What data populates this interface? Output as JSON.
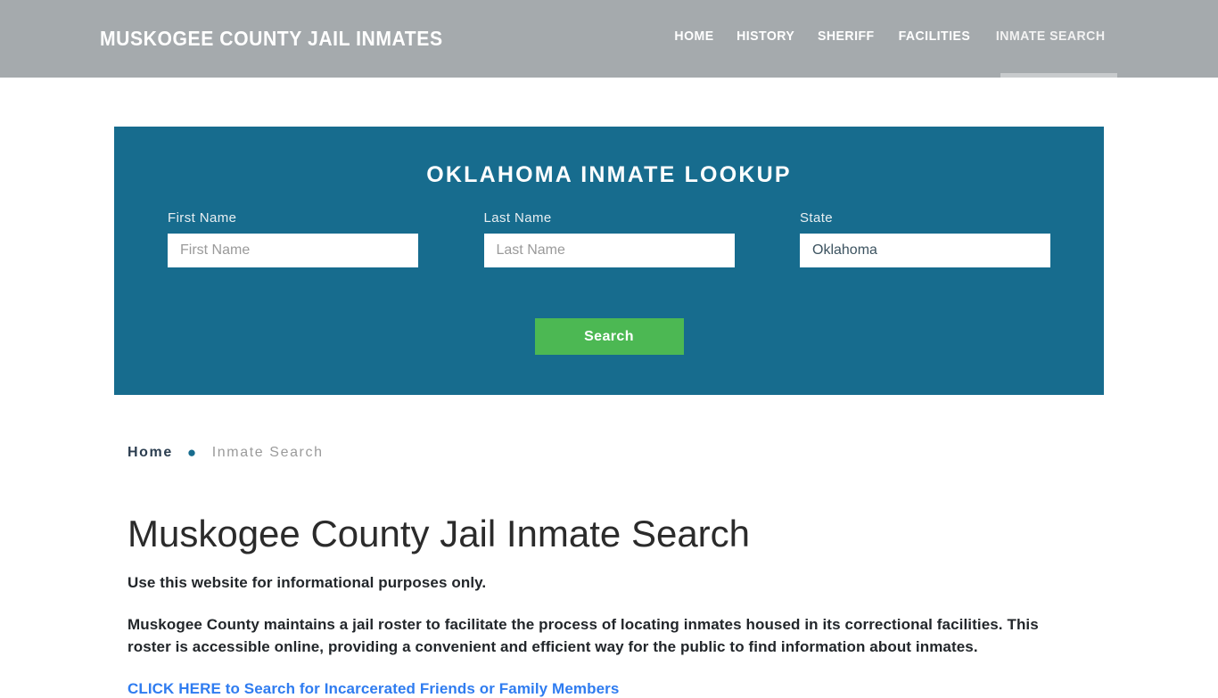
{
  "header": {
    "brand": "MUSKOGEE COUNTY JAIL INMATES",
    "nav": [
      {
        "label": "HOME",
        "active": false
      },
      {
        "label": "HISTORY",
        "active": false
      },
      {
        "label": "SHERIFF",
        "active": false
      },
      {
        "label": "FACILITIES",
        "active": false
      },
      {
        "label": "INMATE SEARCH",
        "active": true
      }
    ],
    "background_color": "#a5aaad"
  },
  "lookup": {
    "title": "OKLAHOMA INMATE LOOKUP",
    "panel_color": "#176c8e",
    "fields": {
      "first_name": {
        "label": "First Name",
        "placeholder": "First Name",
        "value": ""
      },
      "last_name": {
        "label": "Last Name",
        "placeholder": "Last Name",
        "value": ""
      },
      "state": {
        "label": "State",
        "value": "Oklahoma"
      }
    },
    "search_button": {
      "label": "Search",
      "color": "#4cb853"
    }
  },
  "breadcrumb": {
    "home": "Home",
    "separator": "●",
    "current": "Inmate Search"
  },
  "main": {
    "title": "Muskogee County Jail Inmate Search",
    "lede": "Use this website for informational purposes only.",
    "paragraph": "Muskogee County maintains a jail roster to facilitate the process of locating inmates housed in its correctional facilities. This roster is accessible online, providing a convenient and efficient way for the public to find information about inmates.",
    "cta_link": "CLICK HERE to Search for Incarcerated Friends or Family Members",
    "cta_link_color": "#2f7cf0"
  }
}
